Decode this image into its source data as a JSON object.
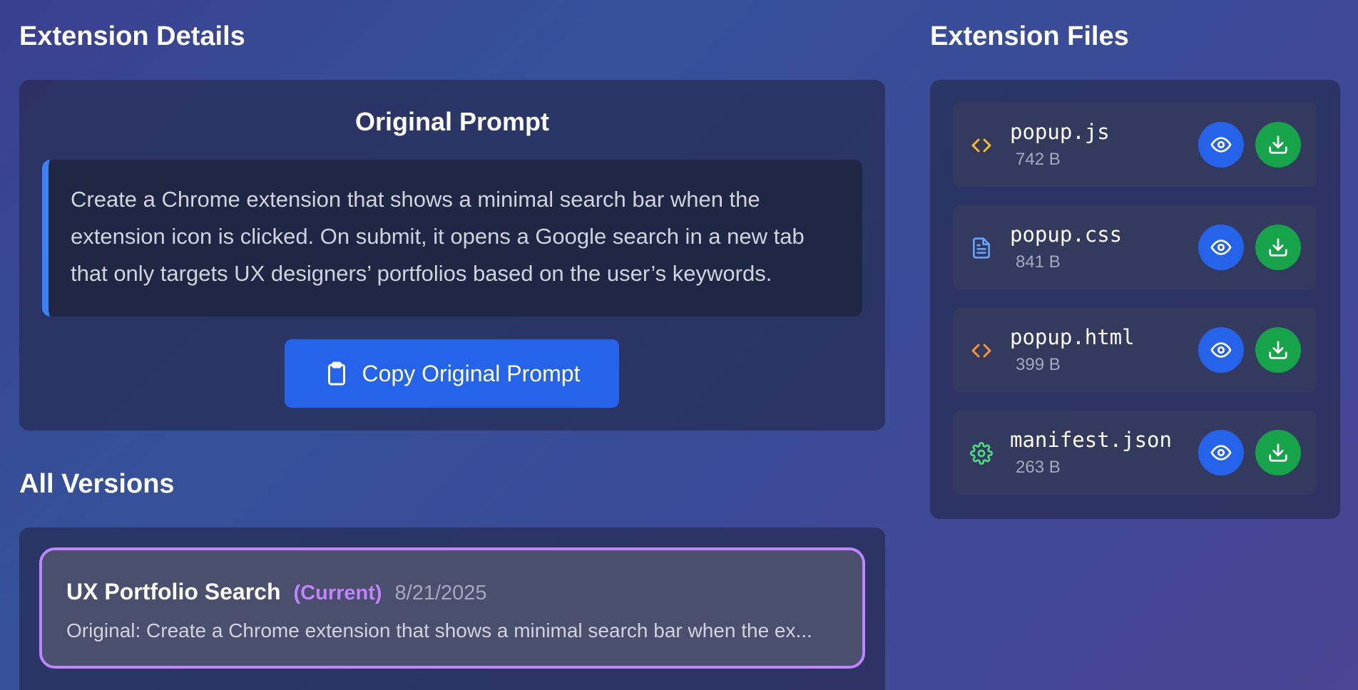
{
  "details": {
    "heading": "Extension Details",
    "prompt_heading": "Original Prompt",
    "prompt_text": "Create a Chrome extension that shows a minimal search bar when the extension icon is clicked. On submit, it opens a Google search in a new tab that only targets UX designers’ portfolios based on the user’s keywords.",
    "copy_button": "Copy Original Prompt",
    "accent_color": "#3b82f6"
  },
  "versions": {
    "heading": "All Versions",
    "items": [
      {
        "title": "UX Portfolio Search",
        "badge": "(Current)",
        "date": "8/21/2025",
        "description": "Original: Create a Chrome extension that shows a minimal search bar when the ex...",
        "highlight_color": "#c084fc"
      }
    ]
  },
  "files": {
    "heading": "Extension Files",
    "items": [
      {
        "name": "popup.js",
        "size": "742 B",
        "icon": "code-icon",
        "icon_color": "#fbbf24"
      },
      {
        "name": "popup.css",
        "size": "841 B",
        "icon": "document-icon",
        "icon_color": "#60a5fa"
      },
      {
        "name": "popup.html",
        "size": "399 B",
        "icon": "code-icon",
        "icon_color": "#fb923c"
      },
      {
        "name": "manifest.json",
        "size": "263 B",
        "icon": "gear-icon",
        "icon_color": "#4ade80"
      }
    ],
    "view_color": "#2563eb",
    "download_color": "#16a34a"
  }
}
